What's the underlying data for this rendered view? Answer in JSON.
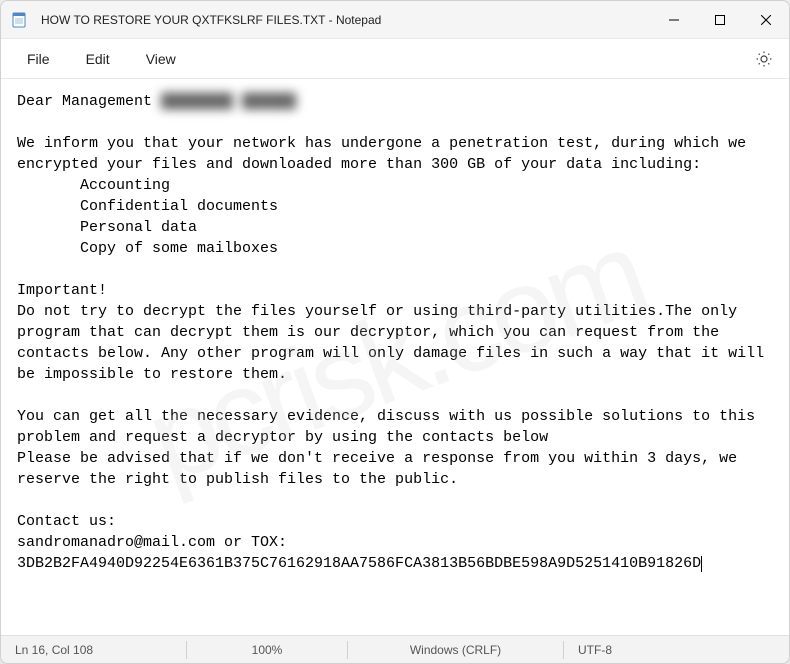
{
  "titlebar": {
    "title": "HOW TO RESTORE YOUR QXTFKSLRF FILES.TXT - Notepad"
  },
  "menu": {
    "file": "File",
    "edit": "Edit",
    "view": "View"
  },
  "doc": {
    "greeting": "Dear Management",
    "redacted": "████████ ██████",
    "p1": "We inform you that your network has undergone a penetration test, during which we encrypted your files and downloaded more than 300 GB of your data including:",
    "li1": "Accounting",
    "li2": "Confidential documents",
    "li3": "Personal data",
    "li4": "Copy of some mailboxes",
    "imp": "Important!",
    "p2": "Do not try to decrypt the files yourself or using third-party utilities.The only program that can decrypt them is our decryptor, which you can request from the contacts below. Any other program will only damage files in such a way that it will be impossible to restore them.",
    "p3a": "You can get all the necessary evidence, discuss with us possible solutions to this problem and request a decryptor by using the contacts below",
    "p3b": "Please be advised that if we don't receive a response from you within 3 days, we reserve the right to publish files to the public.",
    "contact_hdr": "Contact us:",
    "contact_line": "sandromanadro@mail.com or TOX: 3DB2B2FA4940D92254E6361B375C76162918AA7586FCA3813B56BDBE598A9D5251410B91826D"
  },
  "status": {
    "pos": "Ln 16, Col 108",
    "zoom": "100%",
    "eol": "Windows (CRLF)",
    "enc": "UTF-8"
  },
  "watermark": "pcrisk.com"
}
